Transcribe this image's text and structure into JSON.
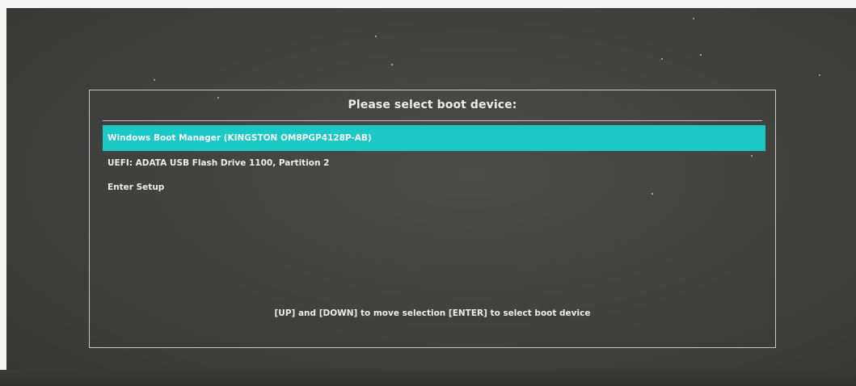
{
  "boot_menu": {
    "title": "Please select boot device:",
    "items": [
      {
        "label": "Windows Boot Manager (KINGSTON OM8PGP4128P-AB)",
        "selected": true
      },
      {
        "label": "UEFI: ADATA USB Flash Drive 1100, Partition 2",
        "selected": false
      },
      {
        "label": "Enter Setup",
        "selected": false
      }
    ],
    "hint": "[UP] and [DOWN] to move selection  [ENTER] to select boot device"
  },
  "colors": {
    "background": "#424240",
    "frame": "#c9c9c4",
    "text": "#ececea",
    "selection": "#1bc8c6"
  }
}
